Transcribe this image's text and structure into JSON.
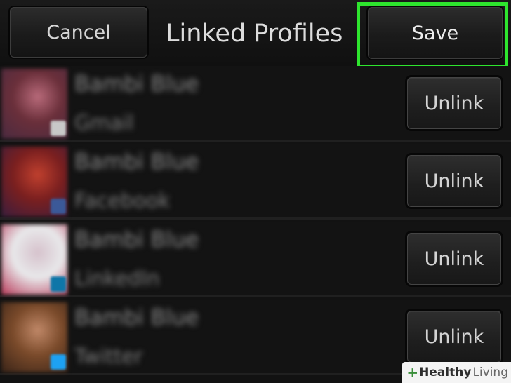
{
  "header": {
    "cancel_label": "Cancel",
    "title": "Linked Profiles",
    "save_label": "Save",
    "highlight_color": "#2ee52e"
  },
  "profiles": [
    {
      "name": "Bambi Blue",
      "service": "Gmail",
      "unlink_label": "Unlink",
      "avatar_colors": [
        "#6a2f3a",
        "#b86a7a",
        "#4a2a40"
      ],
      "badge_color": "#c8c8c8"
    },
    {
      "name": "Bambi Blue",
      "service": "Facebook",
      "unlink_label": "Unlink",
      "avatar_colors": [
        "#7a1f1f",
        "#c0402e",
        "#3a1e3e"
      ],
      "badge_color": "#3b5998"
    },
    {
      "name": "Bambi Blue",
      "service": "LinkedIn",
      "unlink_label": "Unlink",
      "avatar_colors": [
        "#e8e8ea",
        "#d6c2cc",
        "#b83a5a"
      ],
      "badge_color": "#0e76a8"
    },
    {
      "name": "Bambi Blue",
      "service": "Twitter",
      "unlink_label": "Unlink",
      "avatar_colors": [
        "#7a4a2a",
        "#c08868",
        "#3a2418"
      ],
      "badge_color": "#1da1f2"
    }
  ],
  "watermark": {
    "plus": "+",
    "brand_bold": "Healthy",
    "brand_light": "Living"
  }
}
